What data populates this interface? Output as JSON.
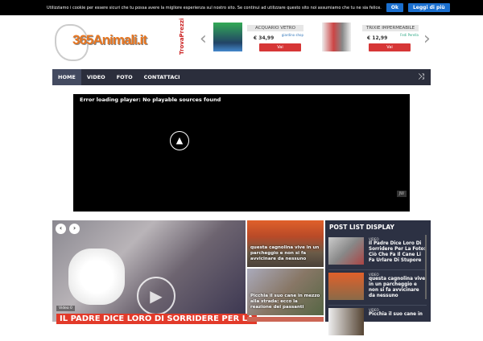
{
  "cookie": {
    "text": "Utilizziamo i cookie per essere sicuri che tu possa avere la migliore esperienza sul nostro sito. Se continui ad utilizzare questo sito noi assumiamo che tu ne sia felice.",
    "ok": "Ok",
    "more": "Leggi di più"
  },
  "header": {
    "logo": "365Animali.it",
    "ads_brand": "TrovaPrezzi",
    "products": [
      {
        "title": "ACQUARIO VETRO",
        "price": "€ 34,99",
        "shop": "giardino shop",
        "button": "Vai"
      },
      {
        "title": "TRIXIE IMPERMEABILE",
        "price": "€ 12,99",
        "shop": "Fedi Perella",
        "button": "Vai"
      }
    ]
  },
  "nav": {
    "items": [
      "HOME",
      "VIDEO",
      "FOTO",
      "CONTATTACI"
    ]
  },
  "player": {
    "error": "Error loading player: No playable sources found",
    "badge": "JW"
  },
  "slider": {
    "meta": "Video  0",
    "title": "IL PADRE DICE LORO DI SORRIDERE PER LA"
  },
  "tiles": [
    "questa cagnolina vive in un parcheggio e non si fa avvicinare da nessuno",
    "Picchia il suo cane in mezzo alla strada: ecco la reazione dei passanti"
  ],
  "sidebar": {
    "title": "POST LIST DISPLAY",
    "posts": [
      {
        "cat": "VIDEO",
        "title": "Il Padre Dice Loro Di Sorridere Per La Foto: Ciò Che Fa Il Cane Li Fa Urlare Di Stupore"
      },
      {
        "cat": "VIDEO",
        "title": "questa cagnolina vive in un parcheggio e non si fa avvicinare da nessuno"
      },
      {
        "cat": "VIDEO",
        "title": "Picchia il suo cane in"
      }
    ]
  }
}
